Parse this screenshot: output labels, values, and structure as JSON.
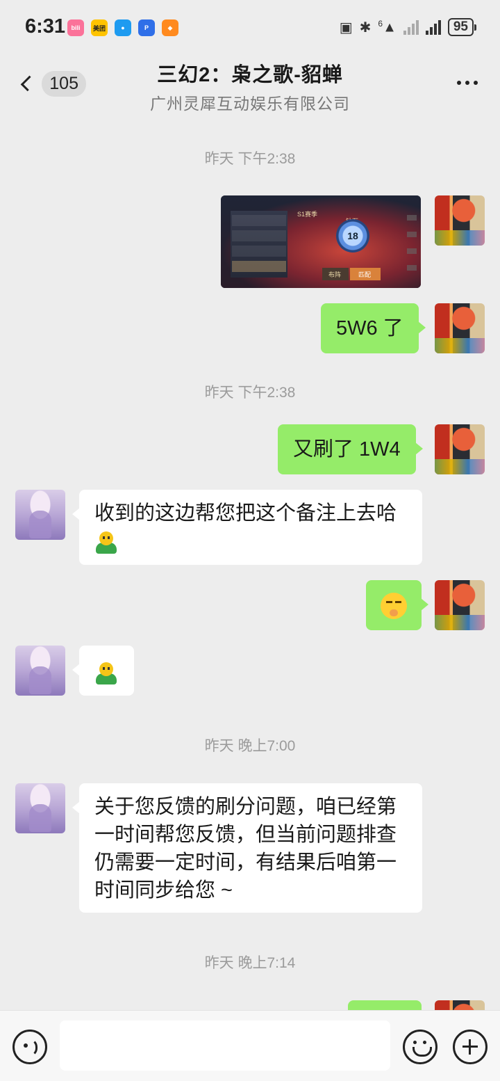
{
  "status_bar": {
    "time": "6:31",
    "apps": [
      {
        "icon": "bilibili-icon",
        "label": "bili",
        "color": "#fb7299"
      },
      {
        "icon": "meituan-icon",
        "label": "美团",
        "color": "#ffc300"
      },
      {
        "icon": "message-icon",
        "label": "",
        "color": "#1e9bf0"
      },
      {
        "icon": "app-p-icon",
        "label": "P",
        "color": "#2f6fe8"
      },
      {
        "icon": "app-orange-icon",
        "label": "",
        "color": "#ff8a1f"
      }
    ],
    "network_label": "6",
    "battery": "95"
  },
  "navbar": {
    "unread_count": "105",
    "title": "三幻2：枭之歌-貂蝉",
    "subtitle": "广州灵犀互动娱乐有限公司"
  },
  "chat": {
    "timestamps": [
      "昨天 下午2:38",
      "昨天 下午2:38",
      "昨天 晚上7:00",
      "昨天 晚上7:14"
    ],
    "screenshot_labels": {
      "season": "S1赛季",
      "rank": "钻石",
      "level": "18",
      "btn_left": "布阵",
      "btn_right": "匹配"
    },
    "messages": [
      {
        "from": "me",
        "text": "5W6 了"
      },
      {
        "from": "me",
        "text": "又刷了 1W4"
      },
      {
        "from": "cs",
        "text": "收到的这边帮您把这个备注上去哈"
      },
      {
        "from": "cs",
        "text": "关于您反馈的刷分问题，咱已经第一时间帮您反馈，但当前问题排查仍需要一定时间，有结果后咱第一时间同步给您 ~"
      }
    ]
  },
  "input": {
    "placeholder": ""
  },
  "colors": {
    "background": "#ededed",
    "my_bubble": "#95ec69",
    "their_bubble": "#ffffff"
  }
}
